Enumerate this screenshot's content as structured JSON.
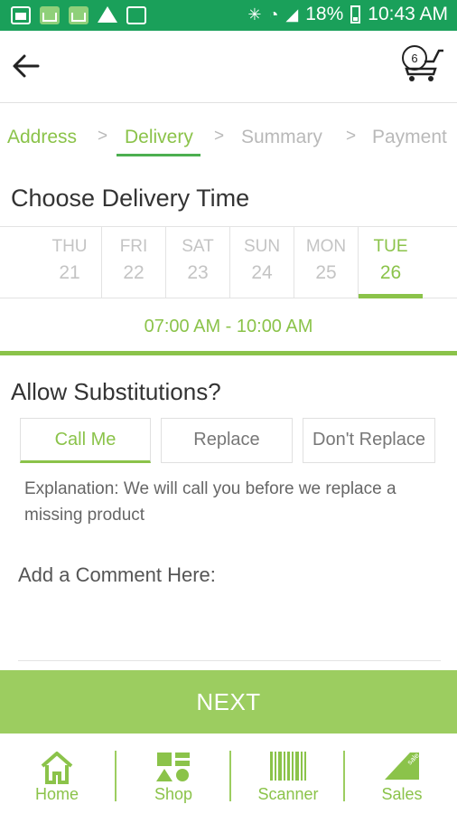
{
  "status_bar": {
    "icons": [
      "gallery-icon",
      "basket-icon",
      "basket-icon",
      "drive-icon",
      "calendar-icon"
    ],
    "right_icons": [
      "bluetooth-icon",
      "wifi-icon",
      "signal-icon",
      "battery-icon"
    ],
    "battery": "18%",
    "time": "10:43 AM"
  },
  "app_bar": {
    "back_icon": "arrow-left-icon",
    "cart_icon": "cart-icon",
    "cart_count": "6"
  },
  "steps": {
    "items": [
      "Address",
      "Delivery",
      "Summary",
      "Payment"
    ],
    "separator": ">"
  },
  "delivery": {
    "title": "Choose Delivery Time",
    "days": [
      {
        "name": "THU",
        "date": "21"
      },
      {
        "name": "FRI",
        "date": "22"
      },
      {
        "name": "SAT",
        "date": "23"
      },
      {
        "name": "SUN",
        "date": "24"
      },
      {
        "name": "MON",
        "date": "25"
      },
      {
        "name": "TUE",
        "date": "26"
      }
    ],
    "selected_day": "TUE",
    "time_slot": "07:00 AM - 10:00 AM"
  },
  "substitutions": {
    "title": "Allow Substitutions?",
    "options": [
      "Call Me",
      "Replace",
      "Don't Replace"
    ],
    "selected": "Call Me",
    "explanation": "Explanation: We will call you before we replace a missing product"
  },
  "comment": {
    "label": "Add a Comment Here:",
    "value": ""
  },
  "next_button": "NEXT",
  "bottom_nav": {
    "items": [
      {
        "label": "Home",
        "icon": "home-icon"
      },
      {
        "label": "Shop",
        "icon": "shapes-icon"
      },
      {
        "label": "Scanner",
        "icon": "barcode-icon"
      },
      {
        "label": "Sales",
        "icon": "sale-tag-icon"
      }
    ],
    "sale_tag_text": "sale"
  },
  "colors": {
    "status_bar": "#1aa05a",
    "accent": "#8bc34a",
    "next_button": "#9ccd60",
    "inactive": "#b9b9b9"
  }
}
